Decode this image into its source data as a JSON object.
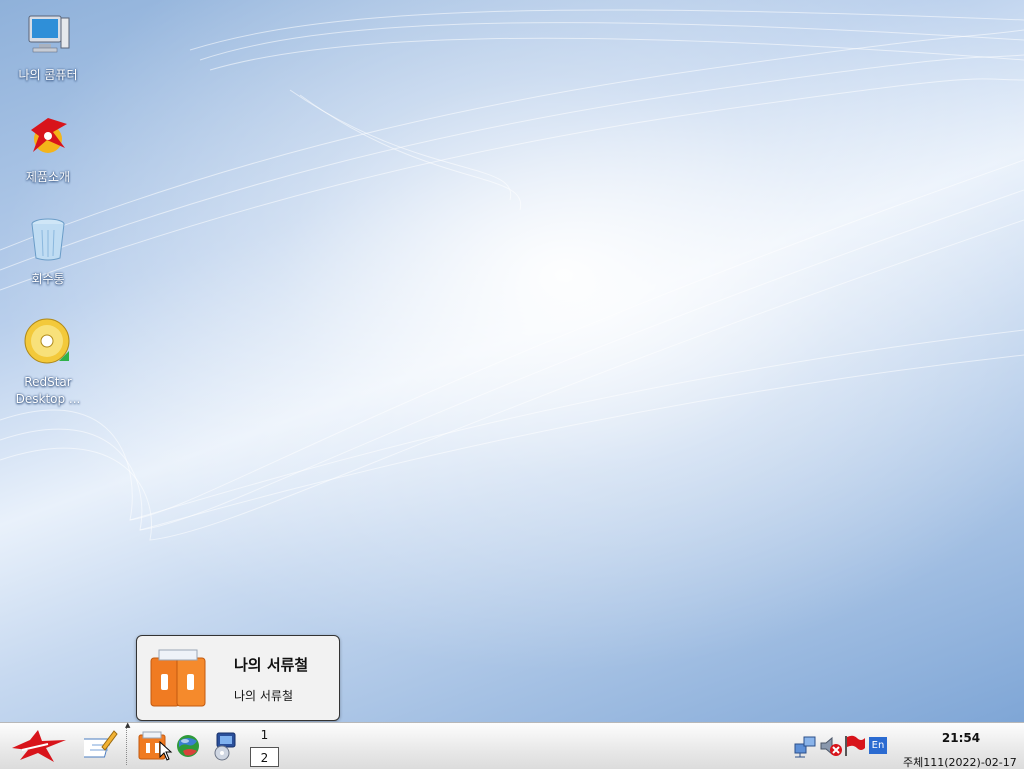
{
  "desktop": {
    "icons": [
      {
        "label": "나의 콤퓨터",
        "icon": "computer-icon"
      },
      {
        "label": "제품소개",
        "icon": "red-star-logo-icon"
      },
      {
        "label": "회수통",
        "icon": "trash-bin-icon"
      },
      {
        "label_line1": "RedStar",
        "label_line2": "Desktop ...",
        "icon": "dvd-disc-icon"
      }
    ]
  },
  "tooltip": {
    "title": "나의 서류철",
    "subtitle": "나의 서류철",
    "icon": "folder-binder-icon"
  },
  "taskbar": {
    "start_icon": "red-star-start-icon",
    "launchers": [
      "notepad-pencil-icon",
      "my-documents-icon",
      "web-browser-globe-icon",
      "media-player-icon"
    ],
    "pager": {
      "desktop1": "1",
      "desktop2": "2",
      "active": "2"
    },
    "tray_icons": [
      "network-icon",
      "volume-muted-icon",
      "flag-icon",
      "input-method-icon"
    ],
    "input_method": "En",
    "clock_time": "21:54",
    "clock_date": "주체111(2022)-02-17"
  },
  "colors": {
    "wallpaper_light": "#e9f1fb",
    "wallpaper_dark": "#7fa6d6",
    "taskbar_bg": "#e8e8e8",
    "tooltip_bg": "#f2f2f2",
    "brand_red": "#d8141b"
  }
}
